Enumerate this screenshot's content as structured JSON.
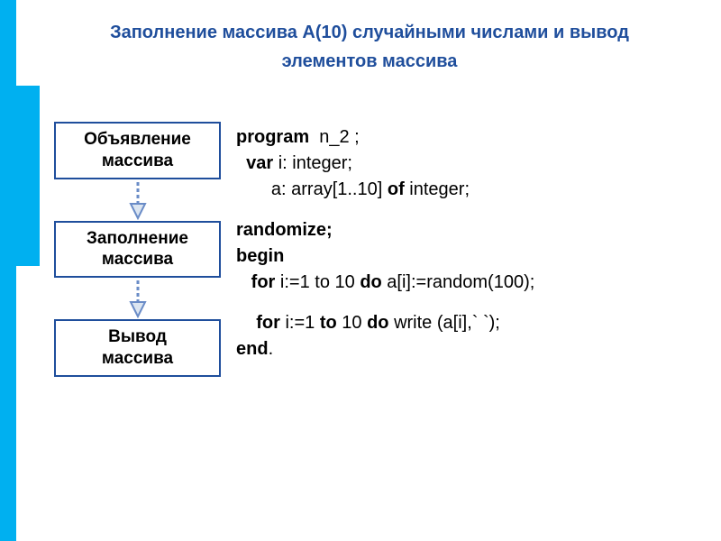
{
  "title_line1": "Заполнение массива A(10) случайными числами и вывод",
  "title_line2": "элементов массива",
  "flow": {
    "declare": "Объявление\nмассива",
    "fill": "Заполнение\nмассива",
    "output": "Вывод\nмассива"
  },
  "code": {
    "l1_kw": "program",
    "l1_rest": "  n_2 ;",
    "l2_pre": "  ",
    "l2_kw": "var",
    "l2_rest": " i: integer;",
    "l3": "       a: array[1..10] ",
    "l3_kw": "of",
    "l3_end": " integer;",
    "l4_kw": "randomize;",
    "l5_kw": "begin",
    "l6_pre": "   ",
    "l6_kw1": "for",
    "l6_mid": " i:=1 to 10 ",
    "l6_kw2": "do",
    "l6_end": " a[i]:=random(100);",
    "l7_pre": "    ",
    "l7_kw1": "for",
    "l7_mid": " i:=1 ",
    "l7_kw2": "to",
    "l7_mid2": " 10 ",
    "l7_kw3": "do",
    "l7_end": " write (a[i],` `);",
    "l8_kw": "end",
    "l8_end": "."
  }
}
